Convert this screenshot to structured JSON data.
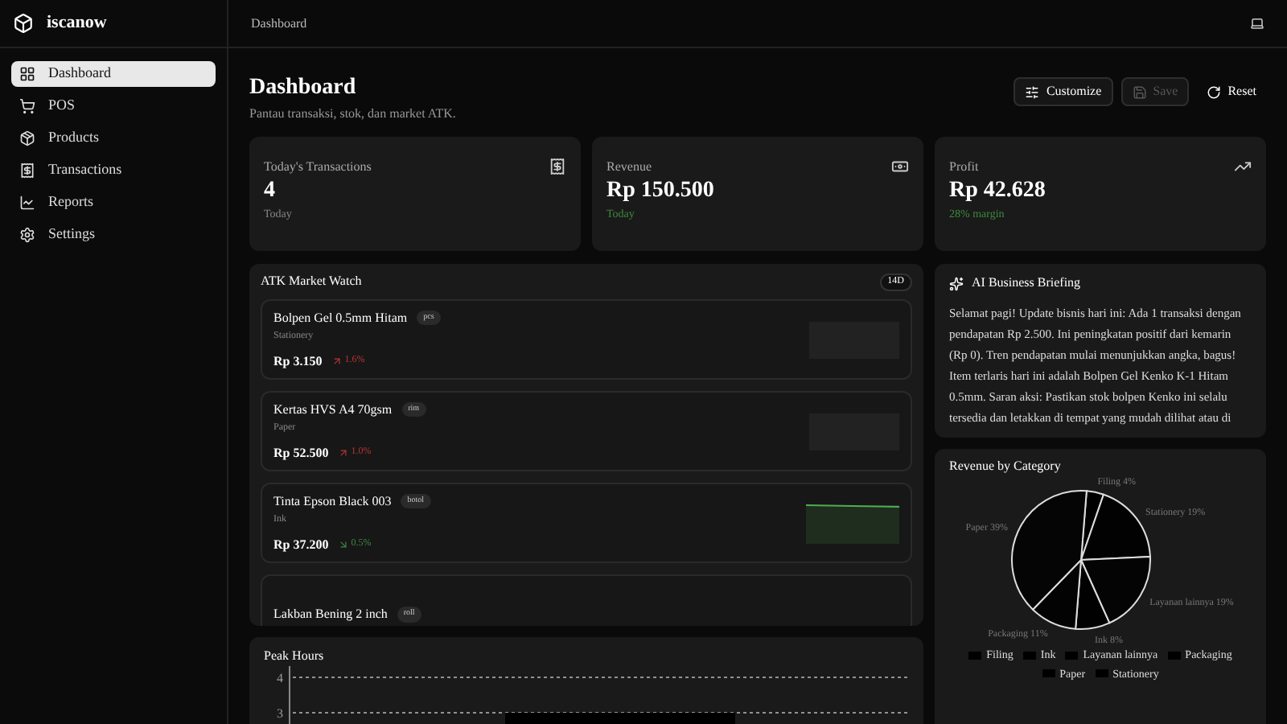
{
  "brand": "iscanow",
  "sidebar": {
    "items": [
      {
        "label": "Dashboard",
        "selected": true
      },
      {
        "label": "POS",
        "selected": false
      },
      {
        "label": "Products",
        "selected": false
      },
      {
        "label": "Transactions",
        "selected": false
      },
      {
        "label": "Reports",
        "selected": false
      },
      {
        "label": "Settings",
        "selected": false
      }
    ]
  },
  "topbar": {
    "breadcrumb": "Dashboard"
  },
  "header": {
    "title": "Dashboard",
    "subtitle": "Pantau transaksi, stok, dan market ATK.",
    "actions": [
      {
        "label": "Customize",
        "disabled": false
      },
      {
        "label": "Save",
        "disabled": true
      },
      {
        "label": "Reset",
        "disabled": false
      }
    ]
  },
  "stats": [
    {
      "label": "Today's Transactions",
      "value": "4",
      "note": "Today",
      "positive": false
    },
    {
      "label": "Revenue",
      "value": "Rp 150.500",
      "note": "Today",
      "positive": true
    },
    {
      "label": "Profit",
      "value": "Rp 42.628",
      "note": "28% margin",
      "positive": true
    }
  ],
  "market": {
    "title": "ATK Market Watch",
    "badge": "14D",
    "items": [
      {
        "name": "Bolpen Gel 0.5mm Hitam",
        "unit": "pcs",
        "category": "Stationery",
        "price": "Rp 3.150",
        "change": "1.6%",
        "rising": true
      },
      {
        "name": "Kertas HVS A4 70gsm",
        "unit": "rim",
        "category": "Paper",
        "price": "Rp 52.500",
        "change": "1.0%",
        "rising": true
      },
      {
        "name": "Tinta Epson Black 003",
        "unit": "botol",
        "category": "Ink",
        "price": "Rp 37.200",
        "change": "0.5%",
        "rising": false
      },
      {
        "name": "Lakban Bening 2 inch",
        "unit": "roll"
      }
    ]
  },
  "peak_hours": {
    "title": "Peak Hours",
    "axis_labels": [
      "4",
      "3"
    ]
  },
  "briefing": {
    "title": "AI Business Briefing",
    "text": "Selamat pagi! Update bisnis hari ini: Ada 1 transaksi dengan pendapatan Rp 2.500. Ini peningkatan positif dari kemarin (Rp 0). Tren pendapatan mulai menunjukkan angka, bagus! Item terlaris hari ini adalah Bolpen Gel Kenko K-1 Hitam 0.5mm. Saran aksi: Pastikan stok bolpen Kenko ini selalu tersedia dan letakkan di tempat yang mudah dilihat atau di"
  },
  "revenue_by_category": {
    "title": "Revenue by Category",
    "chart_data": {
      "type": "pie",
      "categories": [
        "Filing",
        "Stationery",
        "Layanan lainnya",
        "Ink",
        "Packaging",
        "Paper"
      ],
      "values": [
        4,
        19,
        19,
        8,
        11,
        39
      ],
      "value_labels": [
        "4%",
        "19%",
        "19%",
        "8%",
        "11%",
        "39%"
      ]
    },
    "legend": [
      "Filing",
      "Ink",
      "Layanan lainnya",
      "Packaging",
      "Paper",
      "Stationery"
    ]
  }
}
